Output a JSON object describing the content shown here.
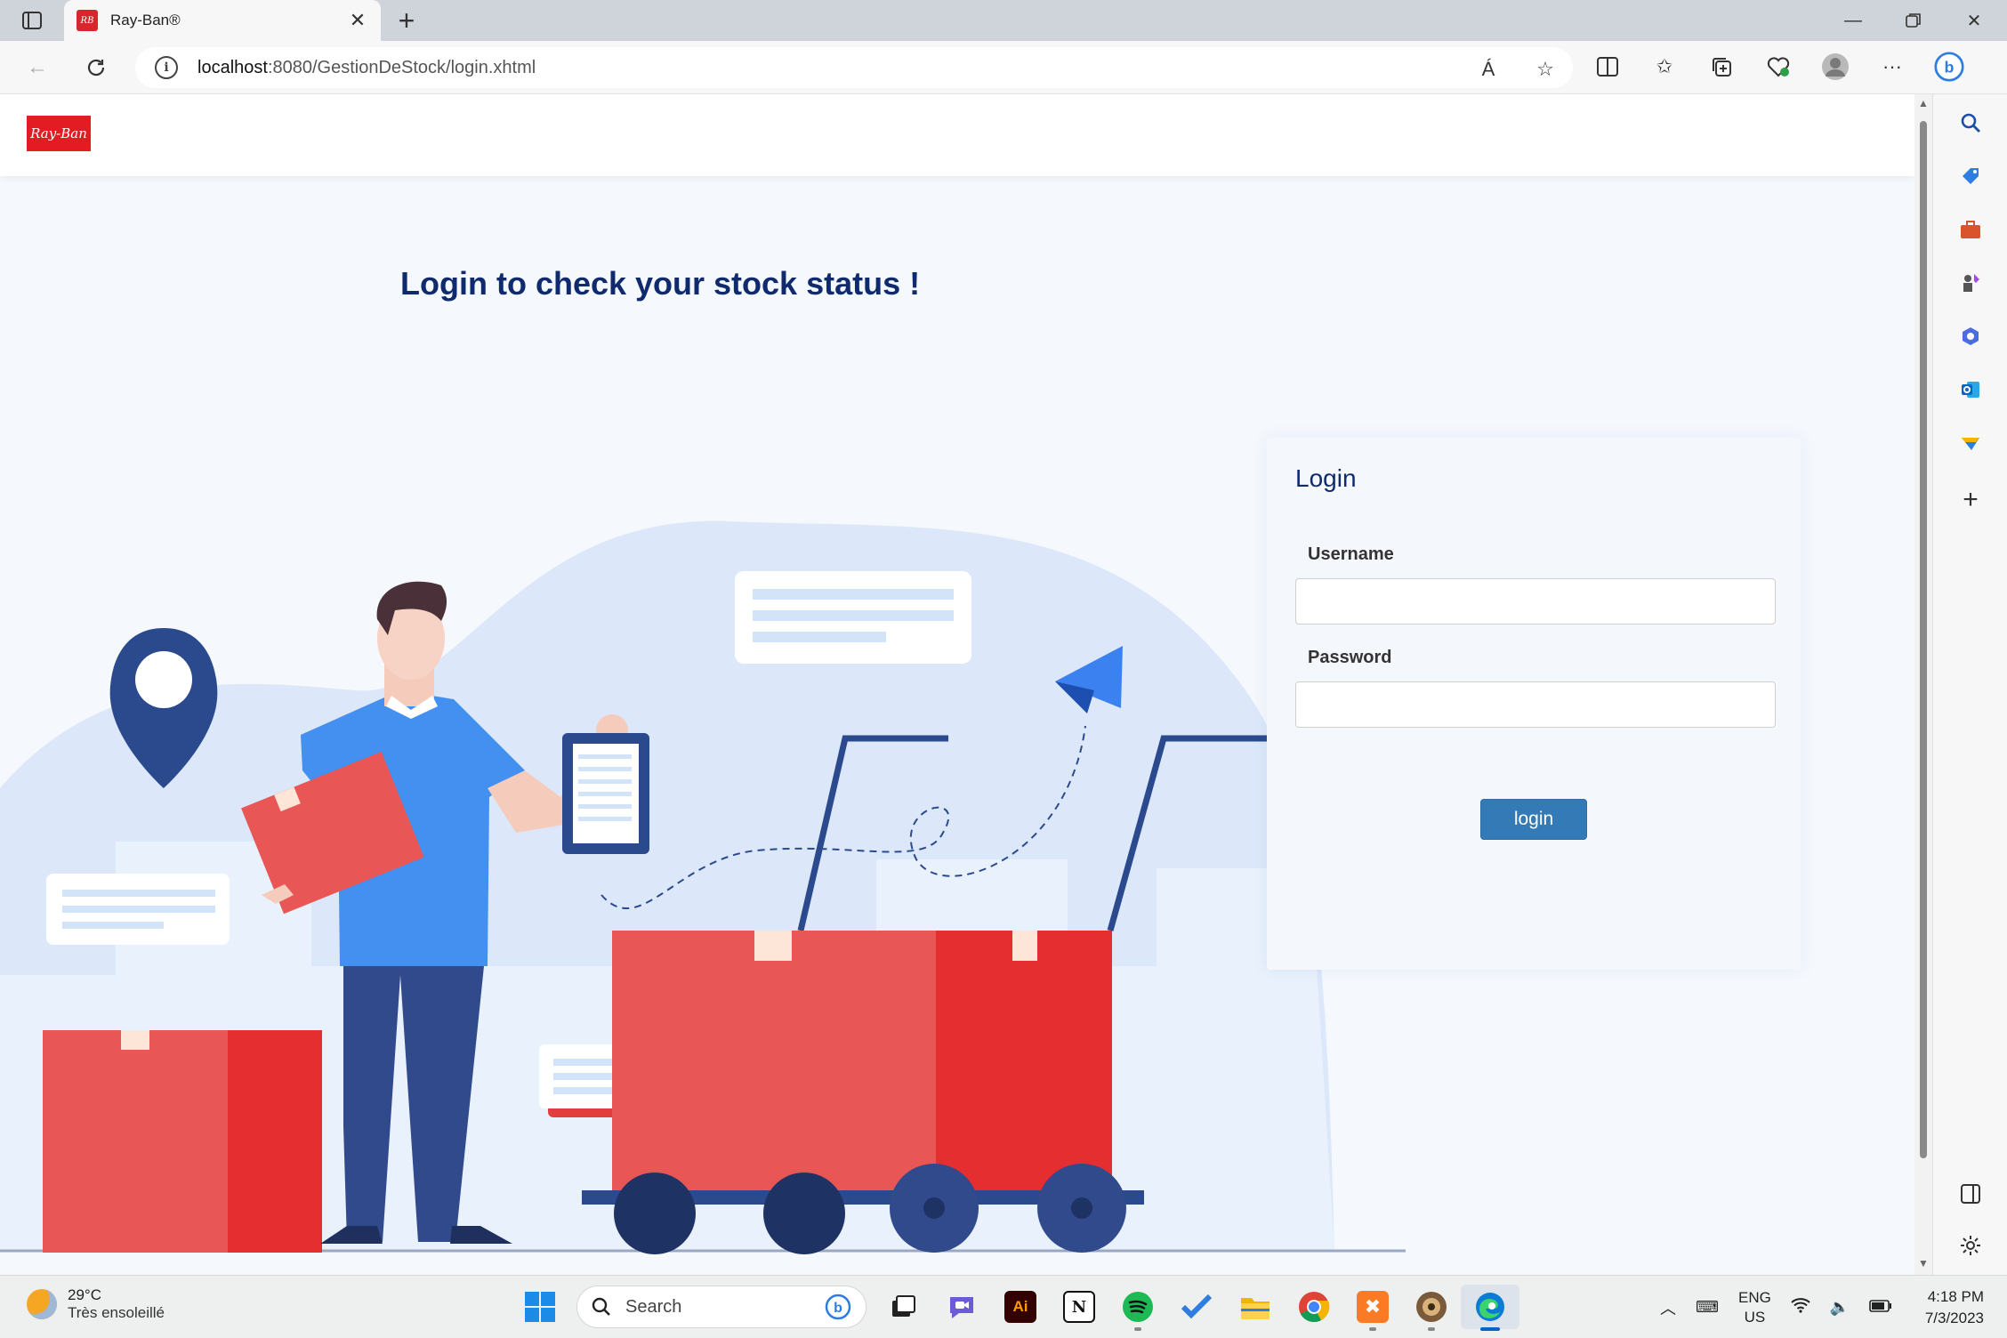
{
  "browser": {
    "tab_title": "Ray-Ban®",
    "favicon_text": "RB",
    "url_host": "localhost",
    "url_rest": ":8080/GestionDeStock/login.xhtml",
    "read_aloud_label": "Á"
  },
  "page": {
    "logo_text": "Ray-Ban",
    "headline": "Login to check your stock status !"
  },
  "login": {
    "title": "Login",
    "username_label": "Username",
    "username_value": "",
    "password_label": "Password",
    "password_value": "",
    "submit_label": "login"
  },
  "taskbar": {
    "weather_temp": "29°C",
    "weather_condition": "Très ensoleillé",
    "search_placeholder": "Search",
    "lang_line1": "ENG",
    "lang_line2": "US",
    "time": "4:18 PM",
    "date": "7/3/2023"
  },
  "colors": {
    "accent_blue": "#337ab7",
    "headline_navy": "#0f2a6d",
    "brand_red": "#e31b23",
    "box_red": "#e85656"
  }
}
